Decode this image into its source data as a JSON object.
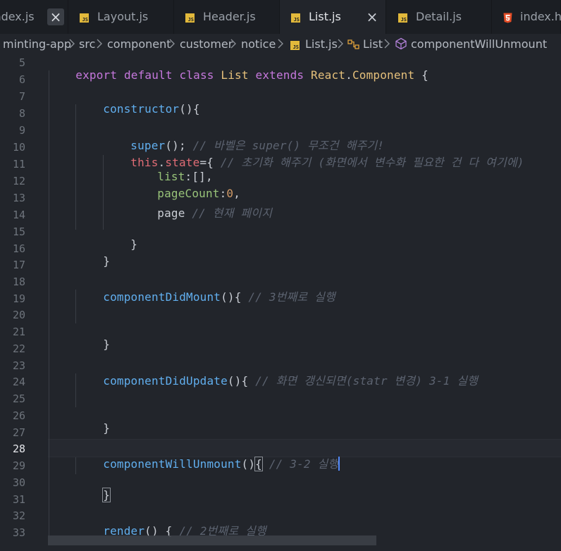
{
  "tabs": [
    {
      "label": "index.js",
      "active": false,
      "icon": "none",
      "close": "×",
      "close_boxed": true
    },
    {
      "label": "Layout.js",
      "active": false,
      "icon": "js-file-icon"
    },
    {
      "label": "Header.js",
      "active": false,
      "icon": "js-file-icon"
    },
    {
      "label": "List.js",
      "active": true,
      "icon": "js-file-icon",
      "close": "×"
    },
    {
      "label": "Detail.js",
      "active": false,
      "icon": "js-file-icon"
    },
    {
      "label": "index.html",
      "active": false,
      "icon": "html5-file-icon"
    }
  ],
  "breadcrumb": {
    "items": [
      "minting-app",
      "src",
      "component",
      "customer",
      "notice",
      "List.js",
      "List",
      "componentWillUnmount"
    ]
  },
  "editor": {
    "current_line": 28,
    "lines": [
      {
        "n": "5",
        "text": "export default class List extends React.Component {"
      },
      {
        "n": "6",
        "text": ""
      },
      {
        "n": "7",
        "text": "constructor(){"
      },
      {
        "n": "8",
        "text": ""
      },
      {
        "n": "9",
        "text": "super(); // 바벨은 super() 무조건 해주기!"
      },
      {
        "n": "10",
        "text": "this.state={ // 초기화 해주기 (화면에서 변수화 필요한 건 다 여기에)"
      },
      {
        "n": "11",
        "text": "list:[],"
      },
      {
        "n": "12",
        "text": "pageCount:0,"
      },
      {
        "n": "13",
        "text": "page // 현재 페이지"
      },
      {
        "n": "14",
        "text": ""
      },
      {
        "n": "15",
        "text": "}"
      },
      {
        "n": "16",
        "text": "}"
      },
      {
        "n": "17",
        "text": ""
      },
      {
        "n": "18",
        "text": "componentDidMount(){ // 3번째로 실행"
      },
      {
        "n": "19",
        "text": ""
      },
      {
        "n": "20",
        "text": ""
      },
      {
        "n": "21",
        "text": "}"
      },
      {
        "n": "22",
        "text": ""
      },
      {
        "n": "23",
        "text": "componentDidUpdate(){ // 화면 갱신되면(statr 변경) 3-1 실행"
      },
      {
        "n": "24",
        "text": ""
      },
      {
        "n": "25",
        "text": ""
      },
      {
        "n": "26",
        "text": "}"
      },
      {
        "n": "27",
        "text": ""
      },
      {
        "n": "28",
        "text": "componentWillUnmount(){ // 3-2 실행"
      },
      {
        "n": "29",
        "text": ""
      },
      {
        "n": "30",
        "text": "}"
      },
      {
        "n": "31",
        "text": ""
      },
      {
        "n": "32",
        "text": "render() { // 2번째로 실행"
      },
      {
        "n": "33",
        "text": ""
      }
    ]
  },
  "colors": {
    "keyword": "#c678dd",
    "class": "#e5c07b",
    "function": "#61afef",
    "property": "#98c379",
    "this": "#e06c75",
    "number": "#d19a66",
    "comment": "#5c6370",
    "cursor": "#528bff",
    "js_icon": "#e2b93b",
    "html_icon": "#e44d26"
  }
}
